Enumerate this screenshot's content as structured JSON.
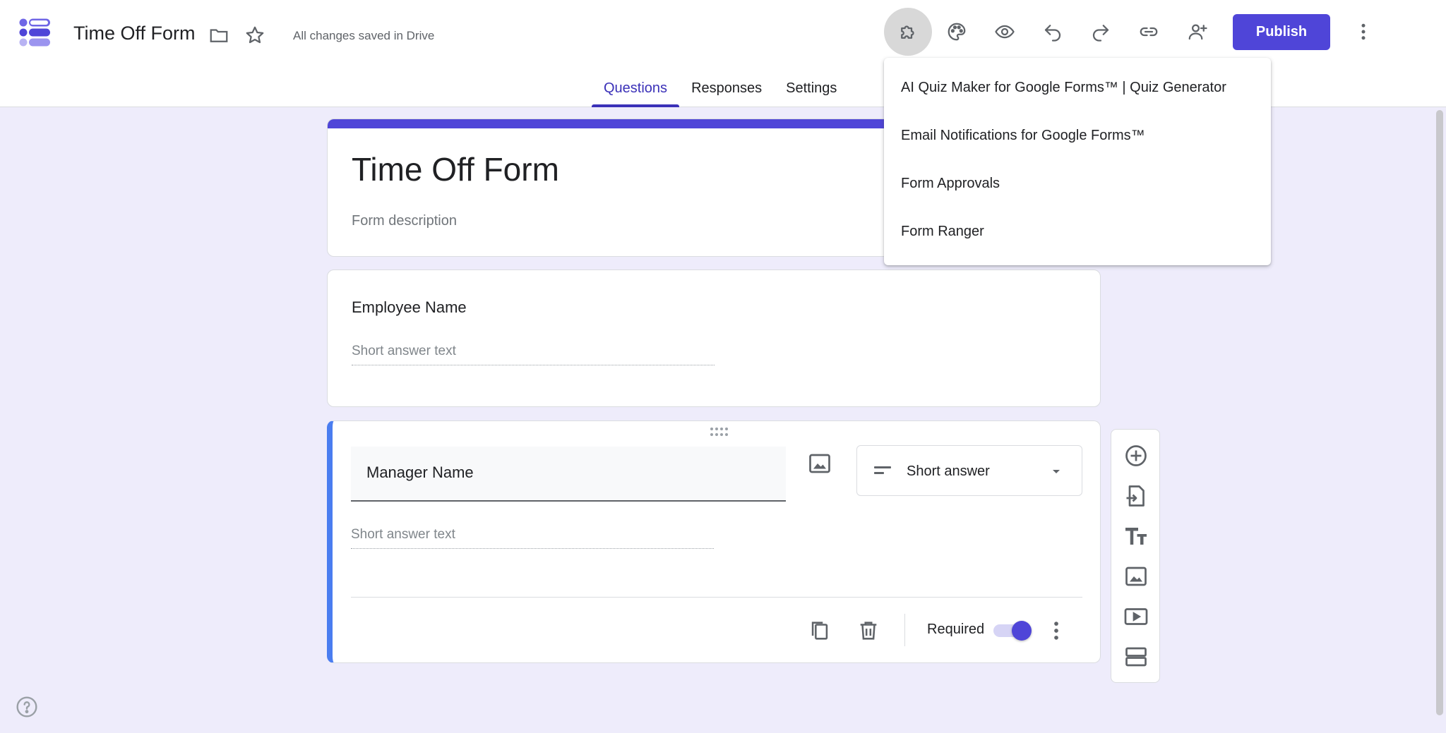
{
  "header": {
    "doc_title": "Time Off Form",
    "saved_status": "All changes saved in Drive",
    "publish_label": "Publish"
  },
  "tabs": [
    {
      "label": "Questions",
      "active": true
    },
    {
      "label": "Responses",
      "active": false
    },
    {
      "label": "Settings",
      "active": false
    }
  ],
  "form": {
    "title": "Time Off Form",
    "description_placeholder": "Form description"
  },
  "questions": [
    {
      "title": "Employee Name",
      "answer_placeholder": "Short answer text"
    },
    {
      "title": "Manager Name",
      "answer_placeholder": "Short answer text",
      "type": "Short answer",
      "required_label": "Required",
      "required": true
    }
  ],
  "addons_menu": {
    "items": [
      "AI Quiz Maker for Google Forms™ | Quiz Generator",
      "Email Notifications for Google Forms™",
      "Form Approvals",
      "Form Ranger"
    ]
  },
  "colors": {
    "accent": "#4f45d8",
    "active_question_border": "#4a7df0",
    "page_background": "#eeecfb"
  },
  "icons": [
    "forms-logo",
    "folder-icon",
    "star-icon",
    "addons-puzzle-icon",
    "palette-icon",
    "preview-eye-icon",
    "undo-icon",
    "redo-icon",
    "link-icon",
    "add-collaborator-icon",
    "more-vert-icon",
    "drag-handle-icon",
    "image-icon",
    "short-answer-icon",
    "dropdown-arrow-icon",
    "duplicate-icon",
    "delete-icon",
    "add-question-icon",
    "import-questions-icon",
    "add-title-icon",
    "add-image-icon",
    "add-video-icon",
    "add-section-icon",
    "help-icon"
  ]
}
